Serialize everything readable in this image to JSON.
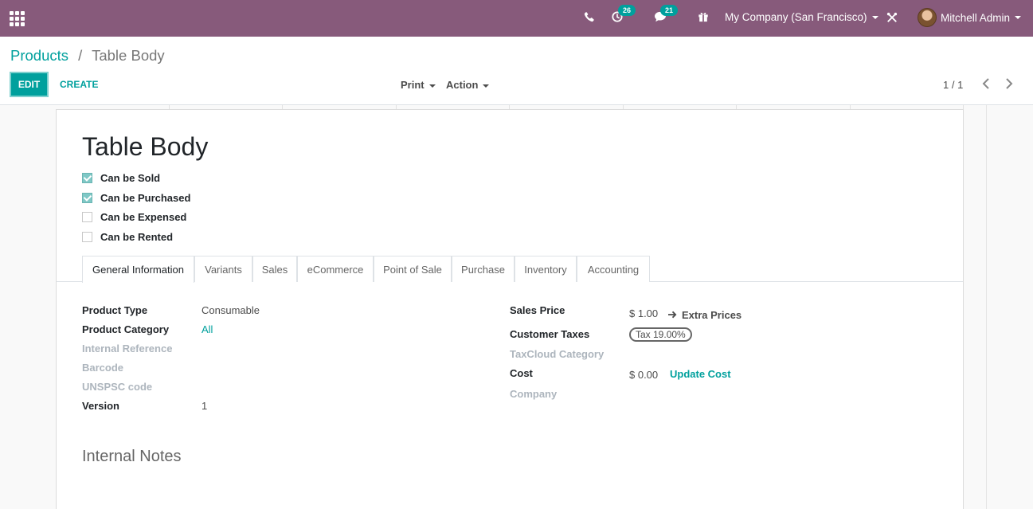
{
  "navbar": {
    "activity_count": "26",
    "messages_count": "21",
    "company": "My Company (San Francisco)",
    "user_name": "Mitchell Admin"
  },
  "breadcrumb": {
    "parent": "Products",
    "separator": "/",
    "current": "Table Body"
  },
  "toolbar": {
    "edit": "EDIT",
    "create": "CREATE",
    "print": "Print",
    "action": "Action"
  },
  "pager": {
    "value": "1 / 1"
  },
  "form": {
    "name": "Table Body",
    "options": [
      {
        "label": "Can be Sold",
        "checked": true
      },
      {
        "label": "Can be Purchased",
        "checked": true
      },
      {
        "label": "Can be Expensed",
        "checked": false
      },
      {
        "label": "Can be Rented",
        "checked": false
      }
    ],
    "tabs": [
      "General Information",
      "Variants",
      "Sales",
      "eCommerce",
      "Point of Sale",
      "Purchase",
      "Inventory",
      "Accounting"
    ],
    "active_tab": "General Information",
    "left_fields": [
      {
        "label": "Product Type",
        "value": "Consumable"
      },
      {
        "label": "Product Category",
        "value": "All"
      },
      {
        "label": "Internal Reference",
        "value": ""
      },
      {
        "label": "Barcode",
        "value": ""
      },
      {
        "label": "UNSPSC code",
        "value": ""
      },
      {
        "label": "Version",
        "value": "1"
      }
    ],
    "right_fields": {
      "sales_price_label": "Sales Price",
      "sales_price": "$ 1.00",
      "extra_prices": "Extra Prices",
      "customer_taxes_label": "Customer Taxes",
      "customer_taxes": "Tax 19.00%",
      "taxcloud_label": "TaxCloud Category",
      "cost_label": "Cost",
      "cost": "$ 0.00",
      "update_cost": "Update Cost",
      "company_label": "Company"
    },
    "internal_notes": "Internal Notes"
  },
  "colors": {
    "navbar": "#875a7b",
    "accent": "#00a09d"
  }
}
